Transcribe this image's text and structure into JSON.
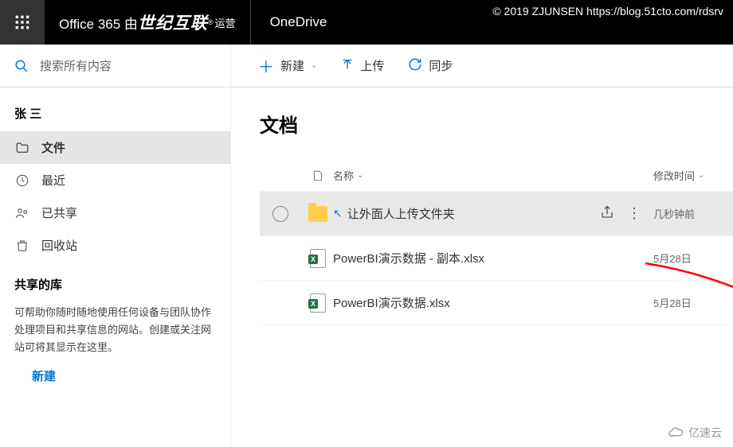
{
  "watermark": "© 2019 ZJUNSEN https://blog.51cto.com/rdsrv",
  "header": {
    "brand_prefix": "Office 365 由",
    "brand_bold": "世纪互联",
    "brand_suffix": "运营",
    "app": "OneDrive"
  },
  "search_placeholder": "搜索所有内容",
  "commands": {
    "new": "新建",
    "upload": "上传",
    "sync": "同步"
  },
  "sidebar": {
    "user": "张 三",
    "items": {
      "files": "文件",
      "recent": "最近",
      "shared": "已共享",
      "recycle": "回收站"
    },
    "section": "共享的库",
    "help": "可帮助你随时随地使用任何设备与团队协作处理项目和共享信息的网站。创建或关注网站可将其显示在这里。",
    "new_link": "新建"
  },
  "page": {
    "title": "文档",
    "col_name": "名称",
    "col_date": "修改时间",
    "tooltip": "共享",
    "rows": [
      {
        "type": "folder",
        "name": "让外面人上传文件夹",
        "date": "几秒钟前",
        "selected": true
      },
      {
        "type": "xlsx",
        "name": "PowerBI演示数据 - 副本.xlsx",
        "date": "5月28日",
        "selected": false
      },
      {
        "type": "xlsx",
        "name": "PowerBI演示数据.xlsx",
        "date": "5月28日",
        "selected": false
      }
    ]
  },
  "footer_brand": "亿速云"
}
